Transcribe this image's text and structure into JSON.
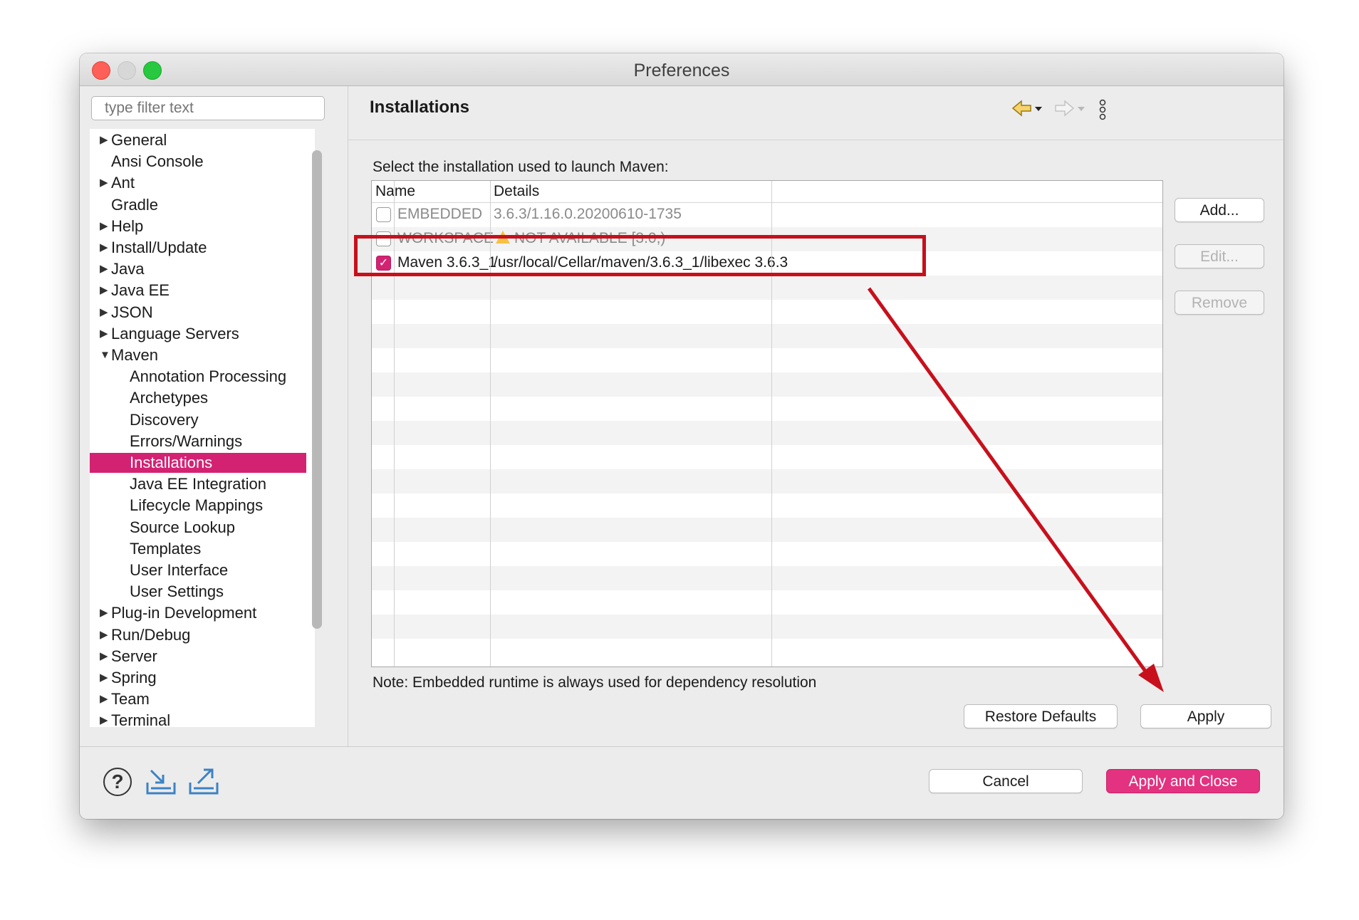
{
  "window": {
    "title": "Preferences"
  },
  "filter": {
    "placeholder": "type filter text"
  },
  "tree": {
    "items": [
      {
        "label": "General",
        "expander": "collapsed",
        "level": 0
      },
      {
        "label": "Ansi Console",
        "expander": "none",
        "level": 0
      },
      {
        "label": "Ant",
        "expander": "collapsed",
        "level": 0
      },
      {
        "label": "Gradle",
        "expander": "none",
        "level": 0
      },
      {
        "label": "Help",
        "expander": "collapsed",
        "level": 0
      },
      {
        "label": "Install/Update",
        "expander": "collapsed",
        "level": 0
      },
      {
        "label": "Java",
        "expander": "collapsed",
        "level": 0
      },
      {
        "label": "Java EE",
        "expander": "collapsed",
        "level": 0
      },
      {
        "label": "JSON",
        "expander": "collapsed",
        "level": 0
      },
      {
        "label": "Language Servers",
        "expander": "collapsed",
        "level": 0
      },
      {
        "label": "Maven",
        "expander": "expanded",
        "level": 0
      },
      {
        "label": "Annotation Processing",
        "expander": "none",
        "level": 1
      },
      {
        "label": "Archetypes",
        "expander": "none",
        "level": 1
      },
      {
        "label": "Discovery",
        "expander": "none",
        "level": 1
      },
      {
        "label": "Errors/Warnings",
        "expander": "none",
        "level": 1
      },
      {
        "label": "Installations",
        "expander": "none",
        "level": 1,
        "selected": true
      },
      {
        "label": "Java EE Integration",
        "expander": "none",
        "level": 1
      },
      {
        "label": "Lifecycle Mappings",
        "expander": "none",
        "level": 1
      },
      {
        "label": "Source Lookup",
        "expander": "none",
        "level": 1
      },
      {
        "label": "Templates",
        "expander": "none",
        "level": 1
      },
      {
        "label": "User Interface",
        "expander": "none",
        "level": 1
      },
      {
        "label": "User Settings",
        "expander": "none",
        "level": 1
      },
      {
        "label": "Plug-in Development",
        "expander": "collapsed",
        "level": 0
      },
      {
        "label": "Run/Debug",
        "expander": "collapsed",
        "level": 0
      },
      {
        "label": "Server",
        "expander": "collapsed",
        "level": 0
      },
      {
        "label": "Spring",
        "expander": "collapsed",
        "level": 0
      },
      {
        "label": "Team",
        "expander": "collapsed",
        "level": 0
      },
      {
        "label": "Terminal",
        "expander": "collapsed",
        "level": 0
      }
    ]
  },
  "page": {
    "title": "Installations",
    "description": "Select the installation used to launch Maven:",
    "note": "Note: Embedded runtime is always used for dependency resolution"
  },
  "installations": {
    "columns": [
      "Name",
      "Details"
    ],
    "rows": [
      {
        "checked": false,
        "name": "EMBEDDED",
        "details": "3.6.3/1.16.0.20200610-1735",
        "dimmed": true,
        "warning": false
      },
      {
        "checked": false,
        "name": "WORKSPACE",
        "details": "NOT AVAILABLE [3.0,)",
        "dimmed": true,
        "warning": true
      },
      {
        "checked": true,
        "name": "Maven 3.6.3_1",
        "details": "/usr/local/Cellar/maven/3.6.3_1/libexec 3.6.3",
        "dimmed": false,
        "warning": false
      }
    ]
  },
  "side_buttons": {
    "add": "Add...",
    "edit": "Edit...",
    "remove": "Remove"
  },
  "page_buttons": {
    "restore": "Restore Defaults",
    "apply": "Apply"
  },
  "dialog_buttons": {
    "cancel": "Cancel",
    "apply_close": "Apply and Close"
  },
  "icons": {
    "nav_back": "back-arrow-icon",
    "nav_forward": "forward-arrow-icon",
    "menu": "vertical-dots-menu-icon",
    "help": "help-icon",
    "import": "import-icon",
    "export": "export-icon"
  },
  "colors": {
    "accent": "#d42273",
    "annotation": "#c7101c",
    "warning": "#f5c242"
  }
}
